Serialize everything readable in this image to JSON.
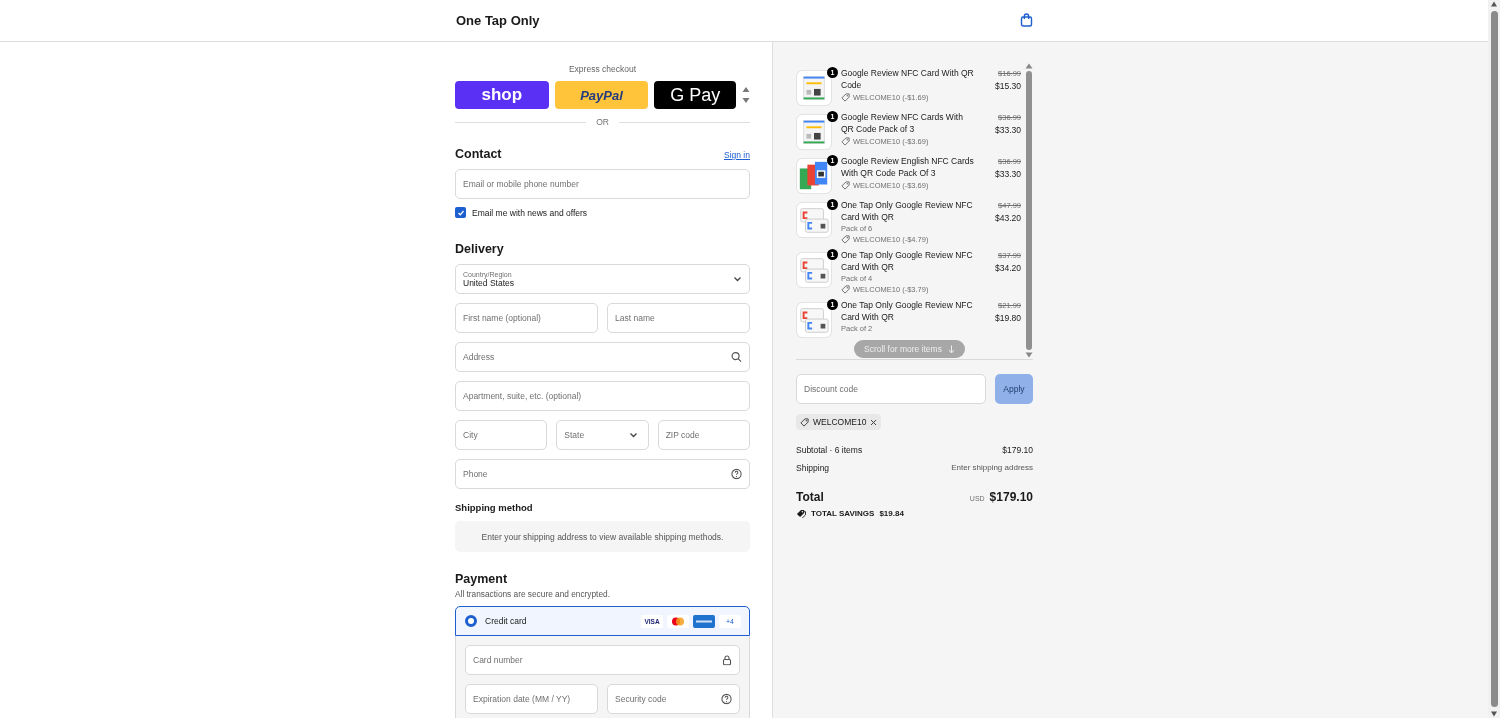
{
  "header": {
    "store_name": "One Tap Only"
  },
  "express": {
    "title": "Express checkout",
    "buttons": [
      {
        "kind": "shop",
        "label": "shop"
      },
      {
        "kind": "paypal",
        "label": "PayPal"
      },
      {
        "kind": "gpay",
        "label": "G Pay"
      }
    ],
    "divider": "OR"
  },
  "contact": {
    "title": "Contact",
    "link": "Sign in",
    "email": {
      "placeholder": "Email or mobile phone number"
    },
    "newsletter": {
      "label": "Email me with news and offers",
      "checked": true
    }
  },
  "delivery": {
    "title": "Delivery",
    "country": {
      "label": "Country/Region",
      "value": "United States"
    },
    "rows": [
      [
        {
          "kind": "input",
          "placeholder": "First name (optional)"
        },
        {
          "kind": "input",
          "placeholder": "Last name"
        }
      ],
      [
        {
          "kind": "address",
          "placeholder": "Address"
        }
      ],
      [
        {
          "kind": "input",
          "placeholder": "Apartment, suite, etc. (optional)"
        }
      ],
      [
        {
          "kind": "input",
          "placeholder": "City"
        },
        {
          "kind": "select",
          "placeholder": "State"
        },
        {
          "kind": "input",
          "placeholder": "ZIP code"
        }
      ],
      [
        {
          "kind": "phone",
          "placeholder": "Phone"
        }
      ]
    ]
  },
  "shipping": {
    "title": "Shipping method",
    "notice": "Enter your shipping address to view available shipping methods."
  },
  "payment": {
    "title": "Payment",
    "subtitle": "All transactions are secure and encrypted.",
    "methods": [
      {
        "label": "Credit card",
        "selected": true,
        "badges": [
          {
            "kind": "visa",
            "text": "VISA"
          },
          {
            "kind": "mastercard"
          },
          {
            "kind": "amex"
          },
          {
            "kind": "more",
            "text": "+4"
          }
        ]
      }
    ],
    "rows": [
      [
        {
          "kind": "card_number",
          "placeholder": "Card number"
        }
      ],
      [
        {
          "kind": "input",
          "placeholder": "Expiration date (MM / YY)"
        },
        {
          "kind": "security_code",
          "placeholder": "Security code"
        }
      ]
    ]
  },
  "summary": {
    "items": [
      {
        "quantity": "1",
        "title": "Google Review NFC Card With QR Code",
        "discount": "WELCOME10 (-$1.69)",
        "original_price": "$16.99",
        "price": "$15.30"
      },
      {
        "quantity": "1",
        "title": "Google Review NFC Cards With QR Code Pack of 3",
        "discount": "WELCOME10 (-$3.69)",
        "original_price": "$36.99",
        "price": "$33.30"
      },
      {
        "quantity": "1",
        "title": "Google Review English NFC Cards With QR Code Pack Of 3",
        "discount": "WELCOME10 (-$3.69)",
        "original_price": "$36.99",
        "price": "$33.30"
      },
      {
        "quantity": "1",
        "title": "One Tap Only Google Review NFC Card With QR",
        "variant": "Pack of 6",
        "discount": "WELCOME10 (-$4.79)",
        "original_price": "$47.99",
        "price": "$43.20"
      },
      {
        "quantity": "1",
        "title": "One Tap Only Google Review NFC Card With QR",
        "variant": "Pack of 4",
        "discount": "WELCOME10 (-$3.79)",
        "original_price": "$37.99",
        "price": "$34.20"
      },
      {
        "quantity": "1",
        "title": "One Tap Only Google Review NFC Card With QR",
        "variant": "Pack of 2",
        "original_price": "$21.99",
        "price": "$19.80"
      }
    ],
    "scroll_hint": "Scroll for more items",
    "discount": {
      "placeholder": "Discount code",
      "button": "Apply",
      "disabled": true
    },
    "applied_codes": [
      "WELCOME10"
    ],
    "subtotal": {
      "label": "Subtotal · 6 items",
      "value": "$179.10"
    },
    "shipping": {
      "label": "Shipping",
      "value": "Enter shipping address"
    },
    "total": {
      "label": "Total",
      "currency": "USD",
      "value": "$179.10"
    },
    "savings": {
      "label": "TOTAL SAVINGS",
      "value": "$19.84"
    }
  }
}
